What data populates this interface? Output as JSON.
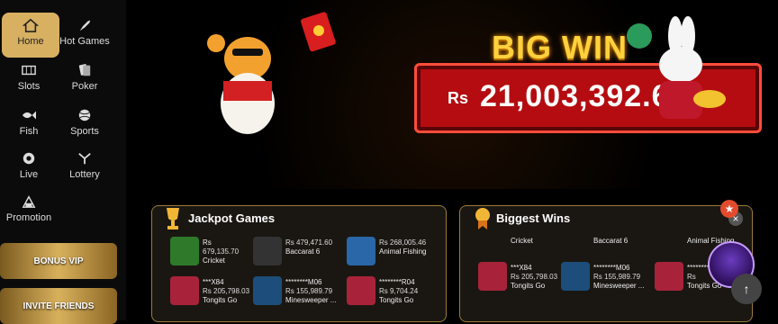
{
  "sidebar": {
    "items": [
      {
        "label": "Home",
        "icon": "home-icon"
      },
      {
        "label": "Hot Games",
        "icon": "rocket-icon"
      },
      {
        "label": "Slots",
        "icon": "slot-icon"
      },
      {
        "label": "Poker",
        "icon": "cards-icon"
      },
      {
        "label": "Fish",
        "icon": "fish-icon"
      },
      {
        "label": "Sports",
        "icon": "ball-icon"
      },
      {
        "label": "Live",
        "icon": "live-icon"
      },
      {
        "label": "Lottery",
        "icon": "lottery-icon"
      },
      {
        "label": "Promotion",
        "icon": "promotion-icon"
      }
    ],
    "promos": [
      {
        "label": "BONUS VIP"
      },
      {
        "label": "INVITE FRIENDS"
      }
    ]
  },
  "banner": {
    "title": "BIG WIN",
    "currency": "Rs",
    "amount": "21,003,392.66"
  },
  "jackpot": {
    "title": "Jackpot Games",
    "items": [
      {
        "line1": "Rs",
        "line2": "679,135.70",
        "game": "Cricket"
      },
      {
        "line1": "",
        "line2": "Rs 479,471.60",
        "game": "Baccarat 6"
      },
      {
        "line1": "",
        "line2": "Rs 268,005.46",
        "game": "Animal Fishing"
      },
      {
        "line1": "***X84",
        "line2": "Rs 205,798.03",
        "game": "Tongits Go"
      },
      {
        "line1": "********M06",
        "line2": "Rs 155,989.79",
        "game": "Minesweeper ..."
      },
      {
        "line1": "********R04",
        "line2": "Rs 9,704.24",
        "game": "Tongits Go"
      }
    ]
  },
  "biggest": {
    "title": "Biggest Wins",
    "items": [
      {
        "line1": "",
        "line2": "",
        "game": "Cricket"
      },
      {
        "line1": "",
        "line2": "",
        "game": "Baccarat 6"
      },
      {
        "line1": "",
        "line2": "",
        "game": "Animal Fishing"
      },
      {
        "line1": "***X84",
        "line2": "Rs 205,798.03",
        "game": "Tongits Go"
      },
      {
        "line1": "********M06",
        "line2": "Rs 155,989.79",
        "game": "Minesweeper ..."
      },
      {
        "line1": "********",
        "line2": "Rs",
        "game": "Tongits Go"
      }
    ]
  },
  "colors": {
    "accent": "#d7b062",
    "banner_red": "#b40c10",
    "gold": "#ffd23d"
  }
}
